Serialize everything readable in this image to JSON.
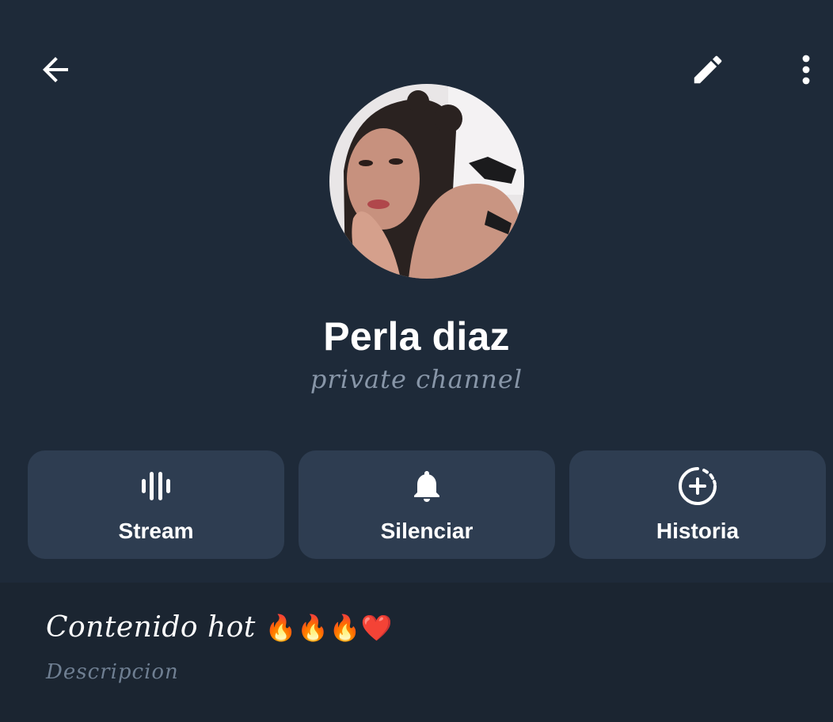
{
  "header": {
    "back_icon": "arrow-left-icon",
    "edit_icon": "pencil-icon",
    "more_icon": "more-vertical-icon"
  },
  "profile": {
    "name": "Perla diaz",
    "subtitle": "private channel",
    "avatar": "profile-photo"
  },
  "actions": [
    {
      "label": "Stream",
      "icon": "stream-bars-icon"
    },
    {
      "label": "Silenciar",
      "icon": "bell-icon"
    },
    {
      "label": "Historia",
      "icon": "add-story-icon"
    }
  ],
  "info": {
    "description_text": "Contenido hot",
    "description_emoji": "🔥🔥🔥❤️",
    "description_label": "Descripcion"
  },
  "colors": {
    "background": "#1e2a39",
    "button_bg": "#2e3d51",
    "info_bg": "#1b2531",
    "muted_text": "#8896a8"
  }
}
